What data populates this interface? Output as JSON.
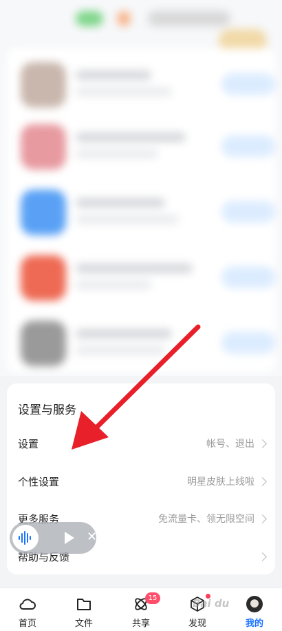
{
  "settings": {
    "section_title": "设置与服务",
    "rows": [
      {
        "label": "设置",
        "detail": "帐号、退出"
      },
      {
        "label": "个性设置",
        "detail": "明星皮肤上线啦"
      },
      {
        "label": "更多服务",
        "detail": "免流量卡、领无限空间"
      },
      {
        "label": "帮助与反馈",
        "detail": ""
      }
    ]
  },
  "bottom_nav": {
    "items": [
      {
        "label": "首页",
        "icon": "cloud-icon"
      },
      {
        "label": "文件",
        "icon": "folder-icon"
      },
      {
        "label": "共享",
        "icon": "atom-icon",
        "badge": "15"
      },
      {
        "label": "发现",
        "icon": "cube-icon"
      },
      {
        "label": "我的",
        "icon": "avatar-icon",
        "active": true
      }
    ]
  },
  "watermark": "Bai du",
  "colors": {
    "accent": "#1a73ff",
    "badge": "#ff4d6a",
    "arrow": "#e8202a"
  }
}
